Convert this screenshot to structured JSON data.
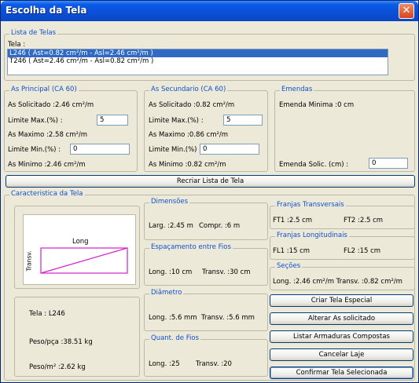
{
  "window": {
    "title": "Escolha da Tela",
    "close_glyph": "✕"
  },
  "lista": {
    "legend": "Lista de Telas",
    "label": "Tela :",
    "items": [
      "L246 ( Ast=0.82 cm²/m - Asl=2.46 cm²/m )",
      "T246 ( Ast=2.46 cm²/m - Asl=0.82 cm²/m )"
    ],
    "selected_index": 0
  },
  "as_principal": {
    "legend": "As Principal (CA 60)",
    "solicitado": "As Solicitado :2.46 cm²/m",
    "limite_max_label": "Limite Max.(%) :",
    "limite_max_value": "5",
    "maximo": "As Maximo :2.58 cm²/m",
    "limite_min_label": "Limite Min.(%) :",
    "limite_min_value": "0",
    "minimo": "As Minimo :2.46 cm²/m"
  },
  "as_secundario": {
    "legend": "As Secundario (CA 60)",
    "solicitado": "As Solicitado :0.82 cm²/m",
    "limite_max_label": "Limite Max.(%) :",
    "limite_max_value": "5",
    "maximo": "As Maximo :0.86 cm²/m",
    "limite_min_label": "Limite Min.(%) :",
    "limite_min_value": "0",
    "minimo": "As Minimo :0.82 cm²/m"
  },
  "emendas": {
    "legend": "Emendas",
    "minima": "Emenda Minima :0 cm",
    "solic_label": "Emenda Solic. (cm) :",
    "solic_value": "0"
  },
  "buttons": {
    "recriar": "Recriar Lista de Tela",
    "criar": "Criar Tela Especial",
    "alterar": "Alterar As solicitado",
    "listar": "Listar Armaduras Compostas",
    "cancelar": "Cancelar Laje",
    "confirmar": "Confirmar Tela Selecionada"
  },
  "caracteristica": {
    "legend": "Caracteristica da Tela",
    "preview": {
      "long_label": "Long",
      "transv_label": "Transv."
    },
    "tela": "Tela : L246",
    "peso_pca": "Peso/pça :38.51 kg",
    "peso_m2": "Peso/m² :2.62 kg",
    "dimensoes": {
      "legend": "Dimensões",
      "larg": "Larg. :2.45 m",
      "compr": "Compr. :6 m"
    },
    "espacamento": {
      "legend": "Espaçamento entre Fios",
      "long": "Long. :10 cm",
      "transv": "Transv. :30 cm"
    },
    "diametro": {
      "legend": "Diâmetro",
      "long": "Long. :5.6 mm",
      "transv": "Transv. :5.6 mm"
    },
    "quant": {
      "legend": "Quant. de Fios",
      "long": "Long. :25",
      "transv": "Transv. :20"
    },
    "franjas_transv": {
      "legend": "Franjas Transversais",
      "ft1": "FT1 :2.5 cm",
      "ft2": "FT2 :2.5 cm"
    },
    "franjas_long": {
      "legend": "Franjas Longitudinais",
      "fl1": "FL1 :15 cm",
      "fl2": "FL2 :15 cm"
    },
    "secoes": {
      "legend": "Seções",
      "text": "Long. :2.46 cm²/m  Transv. :0.82 cm²/m"
    }
  },
  "colors": {
    "accent": "#1050D0",
    "preview_line": "#D020D0",
    "selection": "#316AC5"
  }
}
